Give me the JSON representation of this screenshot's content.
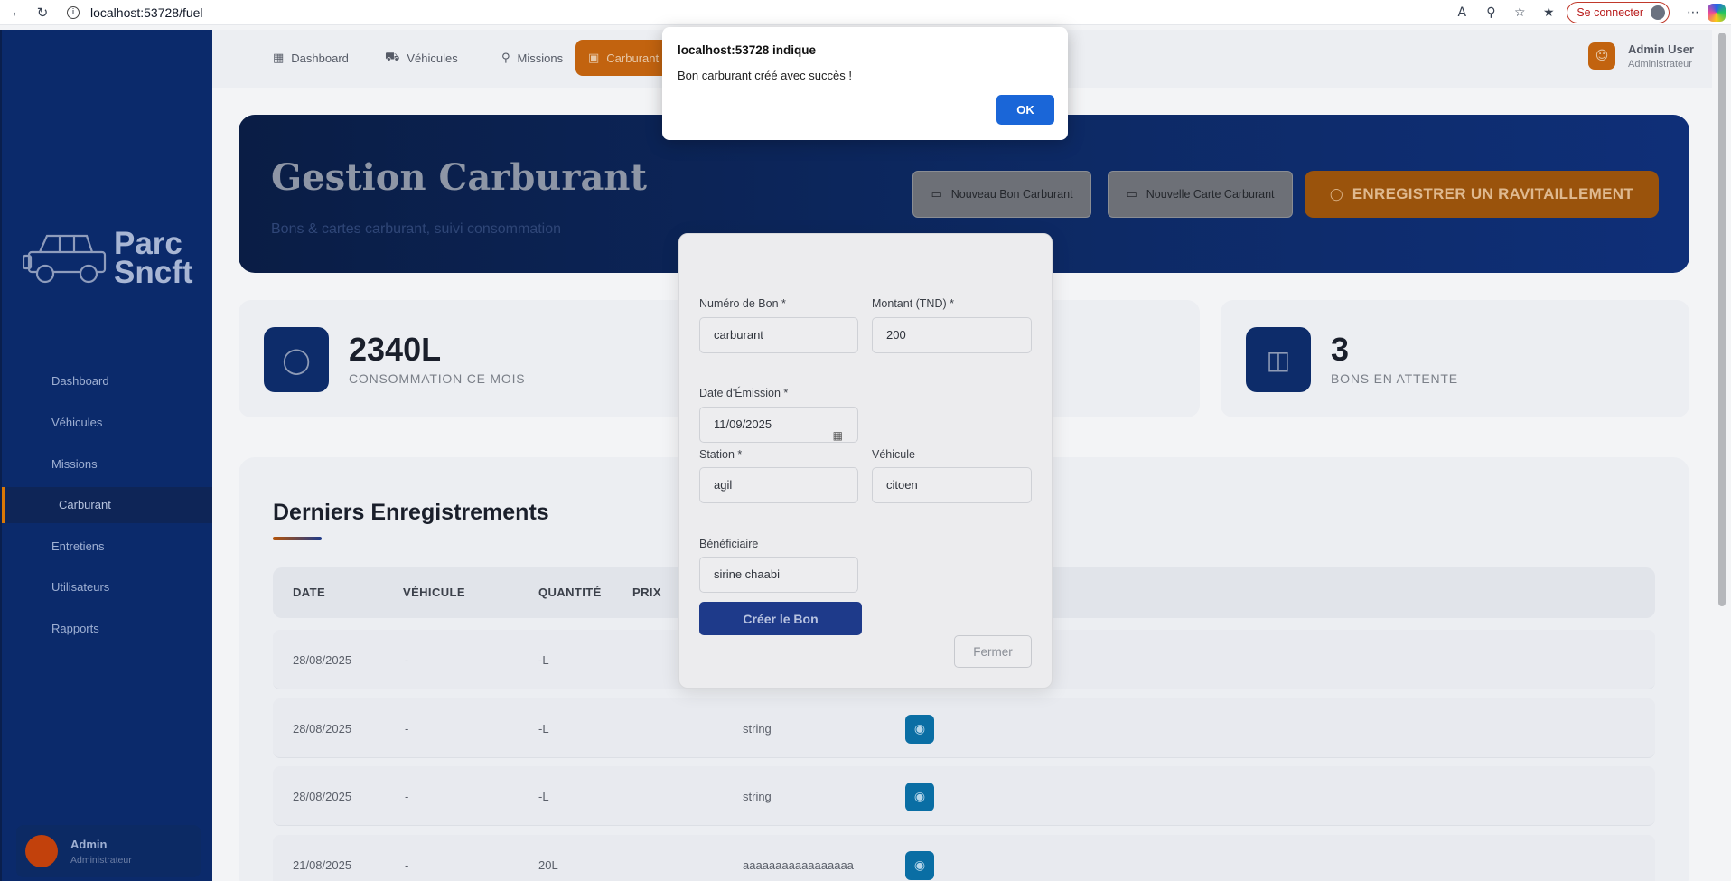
{
  "browser": {
    "url": "localhost:53728/fuel",
    "connect_label": "Se connecter"
  },
  "sidebar": {
    "logo_line1": "Parc",
    "logo_line2": "Sncft",
    "items": [
      {
        "label": "Dashboard"
      },
      {
        "label": "Véhicules"
      },
      {
        "label": "Missions"
      },
      {
        "label": "Carburant"
      },
      {
        "label": "Entretiens"
      },
      {
        "label": "Utilisateurs"
      },
      {
        "label": "Rapports"
      }
    ],
    "active_index": 3,
    "user_name": "Admin",
    "user_role": "Administrateur"
  },
  "topnav": {
    "tabs": [
      {
        "label": "Dashboard",
        "icon": "dashboard-icon"
      },
      {
        "label": "Véhicules",
        "icon": "car-icon"
      },
      {
        "label": "Missions",
        "icon": "location-pin-icon"
      },
      {
        "label": "Carburant",
        "icon": "fuel-icon"
      }
    ],
    "user_name": "Admin User",
    "user_role": "Administrateur"
  },
  "hero": {
    "title": "Gestion Carburant",
    "subtitle": "Bons & cartes carburant, suivi consommation",
    "btn_new_bon": "Nouveau Bon Carburant",
    "btn_new_card": "Nouvelle Carte Carburant",
    "btn_refuel": "ENREGISTRER UN RAVITAILLEMENT"
  },
  "stats": [
    {
      "value": "2340L",
      "label": "CONSOMMATION CE MOIS",
      "icon": "fuel-drop-icon"
    },
    {
      "value": "3",
      "label": "BONS EN ATTENTE",
      "icon": "inbox-icon"
    }
  ],
  "table": {
    "title": "Derniers Enregistrements",
    "headers": [
      "DATE",
      "VÉHICULE",
      "QUANTITÉ",
      "PRIX"
    ],
    "rows": [
      {
        "date": "28/08/2025",
        "vehicle": "-",
        "qty": "-L",
        "text": ""
      },
      {
        "date": "28/08/2025",
        "vehicle": "-",
        "qty": "-L",
        "text": "string"
      },
      {
        "date": "28/08/2025",
        "vehicle": "-",
        "qty": "-L",
        "text": "string"
      },
      {
        "date": "21/08/2025",
        "vehicle": "-",
        "qty": "20L",
        "text": "aaaaaaaaaaaaaaaaa"
      }
    ]
  },
  "modal": {
    "numero_label": "Numéro de Bon *",
    "numero_value": "carburant",
    "montant_label": "Montant (TND) *",
    "montant_value": "200",
    "date_label": "Date d'Émission *",
    "date_value": "11/09/2025",
    "station_label": "Station *",
    "station_value": "agil",
    "vehicule_label": "Véhicule",
    "vehicule_value": "citoen",
    "beneficiaire_label": "Bénéficiaire",
    "beneficiaire_value": "sirine chaabi",
    "create_label": "Créer le Bon",
    "close_label": "Fermer"
  },
  "alert": {
    "title": "localhost:53728 indique",
    "message": "Bon carburant créé avec succès !",
    "ok_label": "OK"
  }
}
